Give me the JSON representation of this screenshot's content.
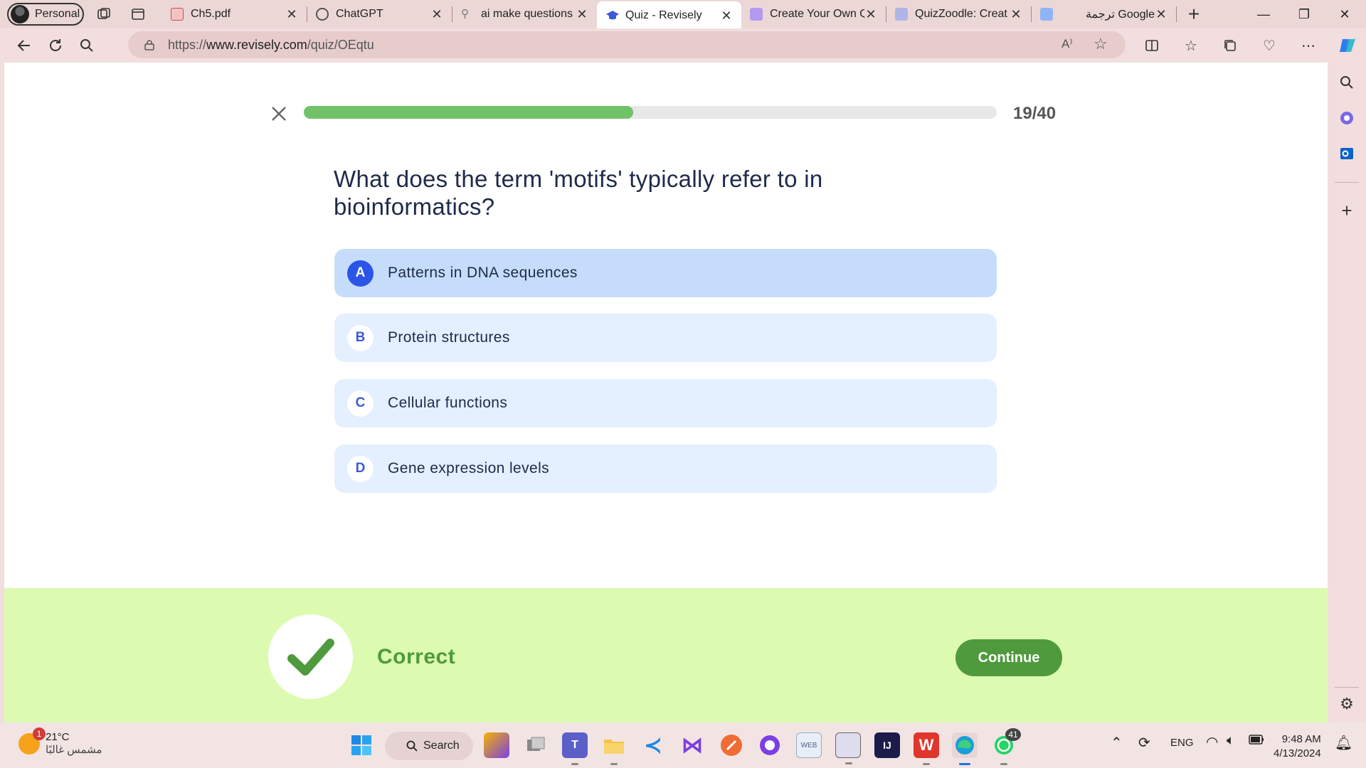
{
  "browser": {
    "profile_label": "Personal",
    "tabs": [
      {
        "title": "Ch5.pdf",
        "icon": "pdf-icon",
        "color": "#d24b4b"
      },
      {
        "title": "ChatGPT",
        "icon": "chatgpt-icon",
        "color": "#444444"
      },
      {
        "title": "ai make questions",
        "icon": "search-icon",
        "color": "#777777"
      },
      {
        "title": "Quiz - Revisely",
        "icon": "graduation-cap-icon",
        "color": "#3b59d9",
        "active": true
      },
      {
        "title": "Create Your Own Q",
        "icon": "quiz-maker-icon",
        "color": "#8b5cf6"
      },
      {
        "title": "QuizZoodle: Creat",
        "icon": "quizzoodle-icon",
        "color": "#6b7bd6"
      },
      {
        "title": "ترجمة Google",
        "icon": "google-translate-icon",
        "color": "#4285f4"
      }
    ],
    "url_prefix": "https://",
    "url_host": "www.revisely.com",
    "url_path": "/quiz/OEqtu"
  },
  "quiz": {
    "progress_current": 19,
    "progress_total": 40,
    "progress_fraction": 0.475,
    "counter_label": "19/40",
    "question": "What does the term 'motifs' typically refer to in bioinformatics?",
    "options": [
      {
        "letter": "A",
        "text": "Patterns in DNA sequences",
        "selected": true
      },
      {
        "letter": "B",
        "text": "Protein structures"
      },
      {
        "letter": "C",
        "text": "Cellular functions"
      },
      {
        "letter": "D",
        "text": "Gene expression levels"
      }
    ],
    "feedback_label": "Correct",
    "continue_label": "Continue"
  },
  "taskbar": {
    "weather_temp": "21°C",
    "weather_desc": "مشمس غالبًا",
    "weather_badge": "1",
    "search_label": "Search",
    "whatsapp_badge": "41",
    "language": "ENG",
    "time": "9:48 AM",
    "date": "4/13/2024"
  },
  "colors": {
    "accent_blue": "#2a55e6",
    "progress_green": "#6fc268",
    "correct_green": "#4f9a3c",
    "feedback_bg": "#dcfbb0"
  }
}
